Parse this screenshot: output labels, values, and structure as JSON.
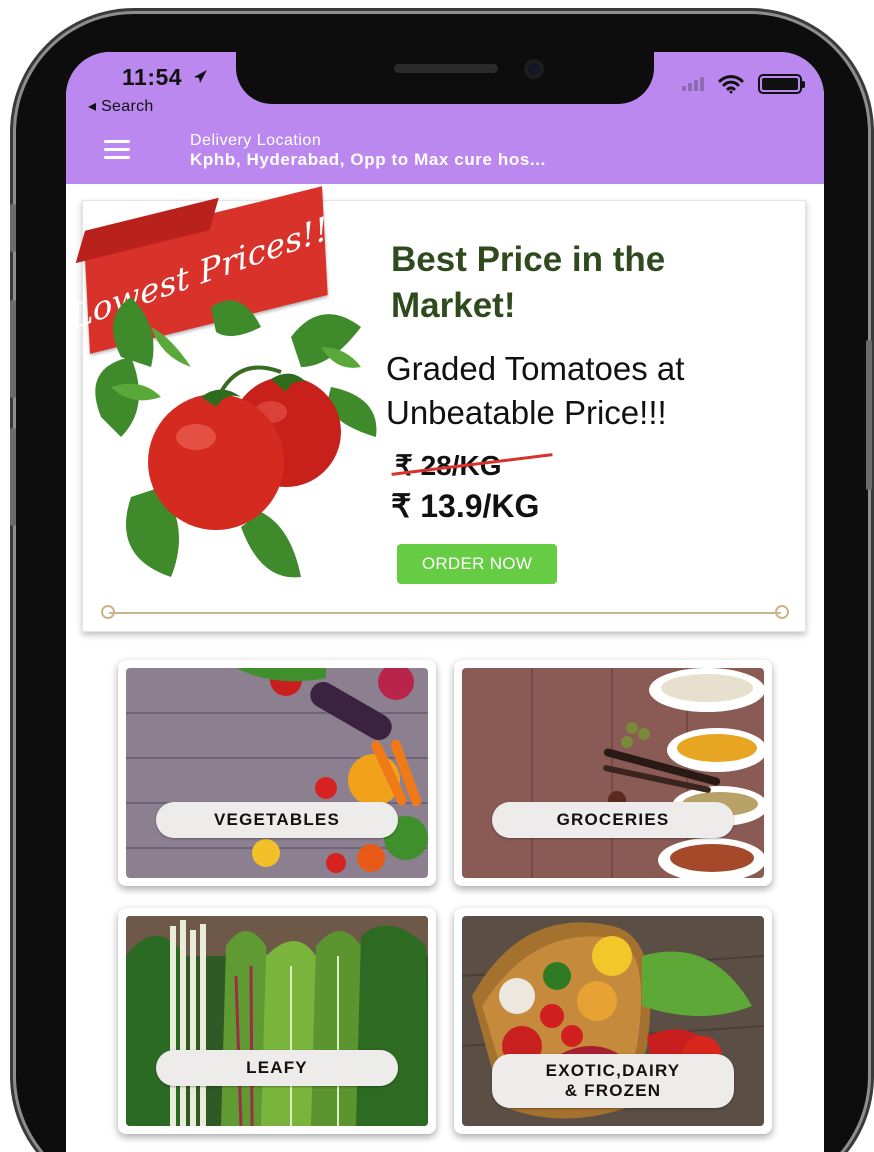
{
  "status_bar": {
    "time": "11:54",
    "back_label": "◂ Search"
  },
  "header": {
    "location_title": "Delivery Location",
    "location_value": "Kphb, Hyderabad, Opp to Max cure hos..."
  },
  "banner": {
    "ribbon_text": "Lowest Prices!!!",
    "headline": "Best Price in the Market!",
    "subtitle": "Graded Tomatoes at Unbeatable Price!!!",
    "old_price": "₹ 28/KG",
    "new_price": "₹ 13.9/KG",
    "cta_label": "ORDER NOW"
  },
  "categories": [
    {
      "label": "VEGETABLES"
    },
    {
      "label": "GROCERIES"
    },
    {
      "label": "LEAFY"
    },
    {
      "label": "EXOTIC,DAIRY\n& FROZEN"
    }
  ],
  "colors": {
    "header_bg": "#bb88f0",
    "headline_green": "#2f4a1c",
    "cta_green": "#66cc44",
    "ribbon_red": "#d8322b"
  },
  "icons": [
    "menu-icon",
    "location-arrow-icon",
    "wifi-icon",
    "battery-icon",
    "signal-icon"
  ]
}
